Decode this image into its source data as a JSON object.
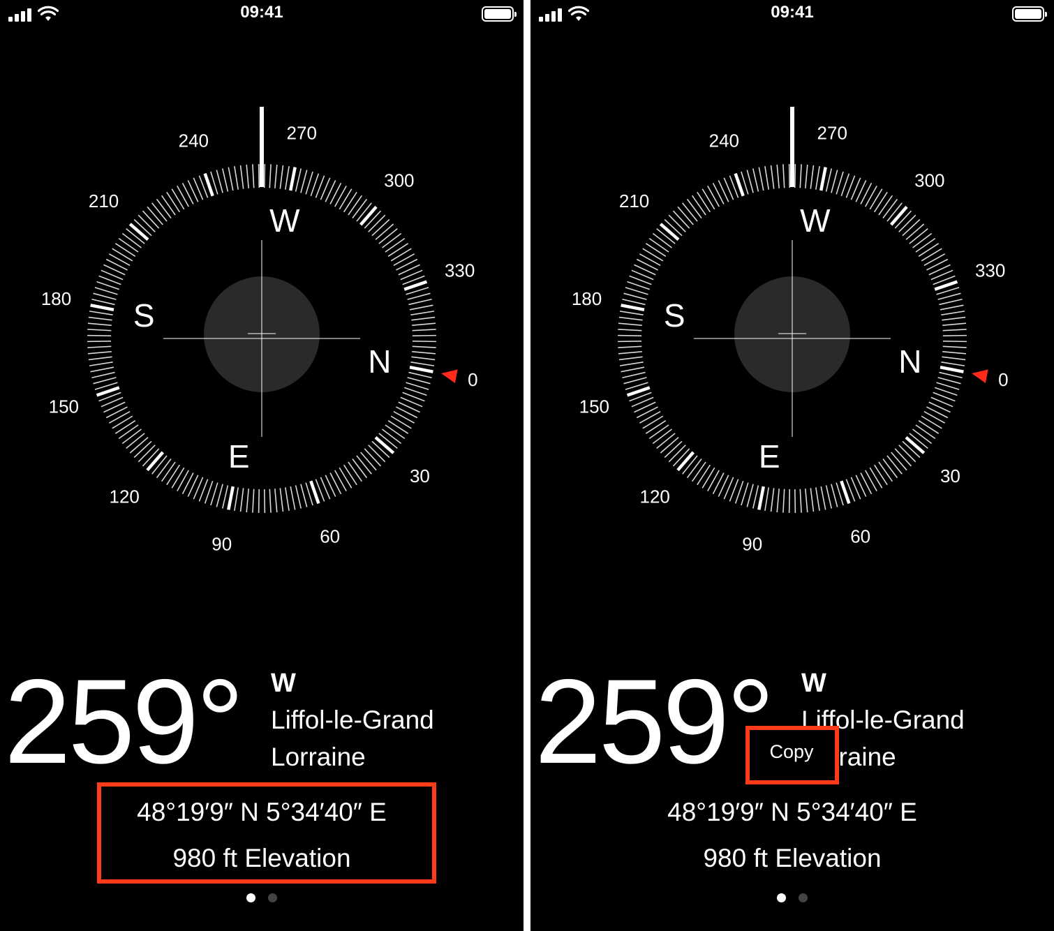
{
  "status_bar": {
    "time": "09:41"
  },
  "compass": {
    "cardinals": {
      "north": "N",
      "east": "E",
      "south": "S",
      "west": "W"
    },
    "degree_labels": [
      "0",
      "30",
      "60",
      "90",
      "120",
      "150",
      "180",
      "210",
      "240",
      "270",
      "300",
      "330"
    ],
    "heading_degrees": 259
  },
  "reading": {
    "heading": "259°",
    "direction": "W",
    "place_line1": "Liffol-le-Grand",
    "place_line2": "Lorraine",
    "coordinates": "48°19′9″ N  5°34′40″ E",
    "elevation": "980 ft Elevation"
  },
  "context_menu": {
    "copy_label": "Copy"
  },
  "page_indicator": {
    "count": 2,
    "current": 1
  },
  "colors": {
    "background": "#000000",
    "foreground": "#ffffff",
    "north_arrow": "#ff2a1a",
    "highlight": "#ff3c1a",
    "center_disc": "#2a2a2a"
  }
}
